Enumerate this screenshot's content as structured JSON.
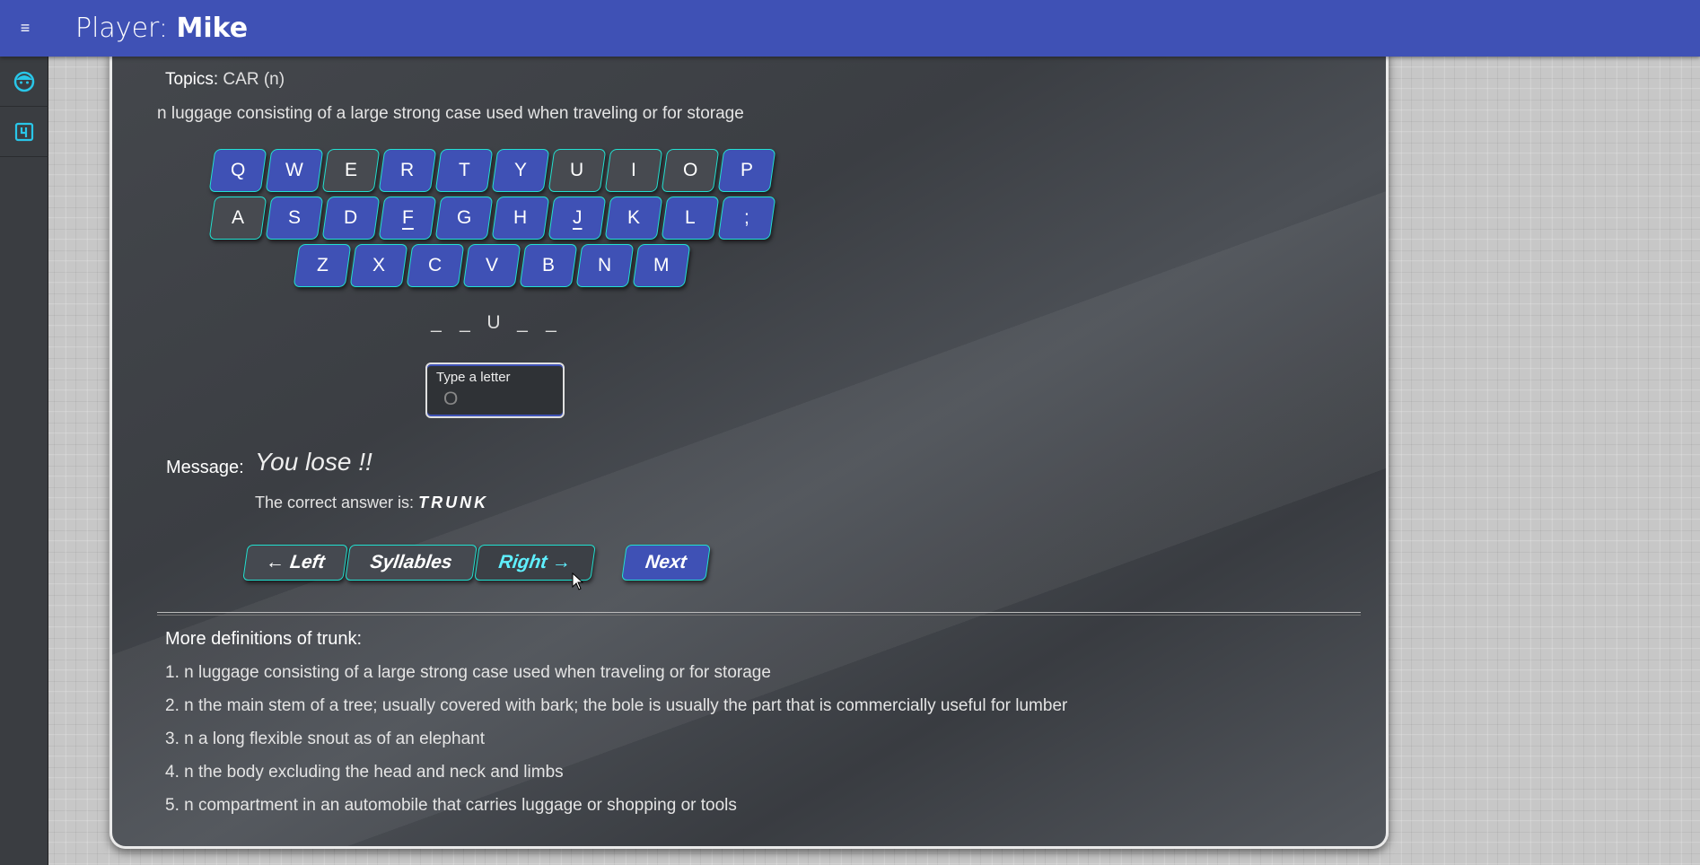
{
  "header": {
    "player_label": "Player:",
    "player_name": "Mike",
    "menu_icon": "≡"
  },
  "sidebar": {
    "items": [
      {
        "icon": "face-icon"
      },
      {
        "icon": "number-four-box-icon"
      }
    ]
  },
  "topics": {
    "label": "Topics:",
    "value": "CAR (n)"
  },
  "definition": "n luggage consisting of a large strong case used when traveling or for storage",
  "keyboard": {
    "row1": [
      "Q",
      "W",
      "E",
      "R",
      "T",
      "Y",
      "U",
      "I",
      "O",
      "P"
    ],
    "row2": [
      "A",
      "S",
      "D",
      "F",
      "G",
      "H",
      "J",
      "K",
      "L",
      ";"
    ],
    "row3": [
      "Z",
      "X",
      "C",
      "V",
      "B",
      "N",
      "M"
    ]
  },
  "word_slots": [
    "_",
    "_",
    "U",
    "_",
    "_"
  ],
  "input": {
    "placeholder": "Type a letter",
    "value": "O"
  },
  "message": {
    "label": "Message:",
    "text": "You lose !!"
  },
  "answer": {
    "prefix": "The correct answer is:",
    "word": "TRUNK"
  },
  "buttons": {
    "left": "← Left",
    "syllables": "Syllables",
    "right": "Right →",
    "next": "Next"
  },
  "more_definitions": {
    "title": "More definitions of trunk:",
    "items": [
      "1. n luggage consisting of a large strong case used when traveling or for storage",
      "2. n the main stem of a tree; usually covered with bark; the bole is usually the part that is commercially useful for lumber",
      "3. n a long flexible snout as of an elephant",
      "4. n the body excluding the head and neck and limbs",
      "5. n compartment in an automobile that carries luggage or shopping or tools"
    ]
  },
  "colors": {
    "primary": "#3f51b5",
    "accent": "#22e0d0",
    "panel": "#3f4247"
  }
}
